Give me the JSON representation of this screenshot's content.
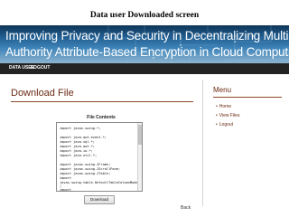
{
  "caption": "Data user Downloaded screen",
  "banner": {
    "title_line1": "Improving Privacy and Security in Decentralizing Multi-",
    "title_line2": "Authority Attribute-Based Encryption in Cloud Computing"
  },
  "nav": {
    "items": [
      {
        "label": "DATA USER"
      },
      {
        "label": "LOGOUT"
      }
    ]
  },
  "main": {
    "title": "Download File",
    "file_contents_label": "File Contents",
    "file_lines": [
      "import javax.swing.*;",
      "",
      "import java.awt.event.*;",
      "import java.sql.*;",
      "import java.awt.*;",
      "import java.io.*;",
      "import java.util.*;",
      "",
      "import javax.swing.JFrame;",
      "import javax.swing.JScrollPane;",
      "import javax.swing.JTable;",
      "import",
      "javax.swing.table.DefaultTableColumnModel",
      ";",
      "import"
    ],
    "download_button": "Download",
    "back_link": "Back"
  },
  "sidebar": {
    "title": "Menu",
    "items": [
      {
        "label": "Home"
      },
      {
        "label": "View Files"
      },
      {
        "label": "Logout"
      }
    ]
  },
  "colors": {
    "accent": "#6b2a12",
    "nav_bg": "#232323",
    "banner_top": "#0e3556",
    "banner_bottom": "#8cb4d0"
  }
}
